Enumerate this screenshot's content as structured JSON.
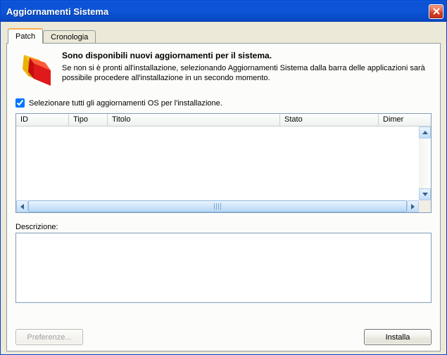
{
  "window": {
    "title": "Aggiornamenti Sistema"
  },
  "tabs": {
    "patch": "Patch",
    "history": "Cronologia"
  },
  "info": {
    "heading": "Sono disponibili nuovi aggiornamenti per il sistema.",
    "sub": "Se non si è pronti all'installazione, selezionando Aggiornamenti Sistema dalla barra delle applicazioni sarà possibile procedere all'installazione in un secondo momento."
  },
  "checkbox": {
    "label": "Selezionare tutti gli aggiornamenti OS per l'installazione."
  },
  "columns": {
    "id": "ID",
    "type": "Tipo",
    "title": "Titolo",
    "status": "Stato",
    "size": "Dimer"
  },
  "description": {
    "label": "Descrizione:"
  },
  "buttons": {
    "preferences": "Preferenze...",
    "install": "Installa"
  }
}
